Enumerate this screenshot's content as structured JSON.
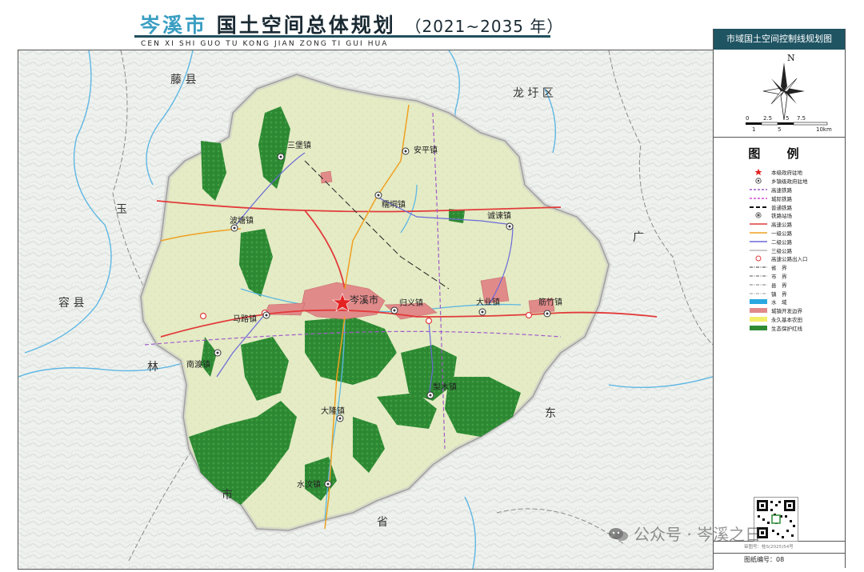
{
  "header": {
    "title_city": "岑溪市",
    "title_rest": "国土空间总体规划",
    "title_years": "（2021~2035 年）",
    "pinyin": "CEN XI SHI GUO TU KONG JIAN ZONG TI GUI HUA"
  },
  "sidebar": {
    "map_title": "市域国土空间控制线规划图",
    "north_label": "N",
    "scale_top": [
      "0",
      "2.5",
      "5",
      "7.5"
    ],
    "scale_bottom": [
      "1",
      "5",
      "10km"
    ],
    "legend_title": "图 例",
    "legend_items": [
      {
        "label": "本级政府驻地",
        "symbol": "star",
        "color": "#e52222"
      },
      {
        "label": "乡镇级政府驻地",
        "symbol": "town",
        "color": "#333333"
      },
      {
        "label": "高速铁路",
        "symbol": "dash",
        "color": "#a05cc9"
      },
      {
        "label": "城际铁路",
        "symbol": "dash",
        "color": "#d04dd0"
      },
      {
        "label": "普通铁路",
        "symbol": "rail",
        "color": "#111111"
      },
      {
        "label": "铁路站场",
        "symbol": "station",
        "color": "#555555"
      },
      {
        "label": "高速公路",
        "symbol": "line",
        "color": "#e23b3b"
      },
      {
        "label": "一级公路",
        "symbol": "line",
        "color": "#f0a020"
      },
      {
        "label": "二级公路",
        "symbol": "line",
        "color": "#6a6ad8"
      },
      {
        "label": "三级公路",
        "symbol": "line",
        "color": "#b8b8b8"
      },
      {
        "label": "高速公路出入口",
        "symbol": "ring",
        "color": "#e23b3b"
      },
      {
        "label": "省　界",
        "symbol": "boundary",
        "color": "#333333"
      },
      {
        "label": "市　界",
        "symbol": "boundary",
        "color": "#555555"
      },
      {
        "label": "县　界",
        "symbol": "boundary",
        "color": "#777777"
      },
      {
        "label": "镇　界",
        "symbol": "boundary",
        "color": "#999999"
      },
      {
        "label": "水　域",
        "symbol": "fill",
        "color": "#29a8e0"
      },
      {
        "label": "城镇开发边界",
        "symbol": "fill",
        "color": "#e08a8a"
      },
      {
        "label": "永久基本农田",
        "symbol": "fill",
        "color": "#f2ef6a"
      },
      {
        "label": "生态保护红线",
        "symbol": "fill",
        "color": "#2e8b34"
      }
    ],
    "audit_no": "审图号：桂S(2025)54号",
    "sheet_no": "图纸编号：08"
  },
  "map": {
    "regions": [
      "藤 县",
      "龙 圩 区",
      "容 县",
      "玉",
      "林",
      "市",
      "东",
      "省",
      "广"
    ],
    "city_seat": "岑溪市",
    "towns": [
      "三堡镇",
      "安平镇",
      "糯垌镇",
      "波塘镇",
      "诚谏镇",
      "归义镇",
      "大业镇",
      "筋竹镇",
      "马路镇",
      "南渡镇",
      "梨木镇",
      "大隆镇",
      "水汶镇"
    ]
  },
  "watermark": "公众号 · 岑溪之日",
  "colors": {
    "accent": "#3a9ec2",
    "header_bar": "#1f5463",
    "county_fill": "#e6ecc8",
    "eco_red_line": "#2e8b34",
    "expressway": "#e23b3b",
    "urban_boundary": "#e08a8a"
  }
}
